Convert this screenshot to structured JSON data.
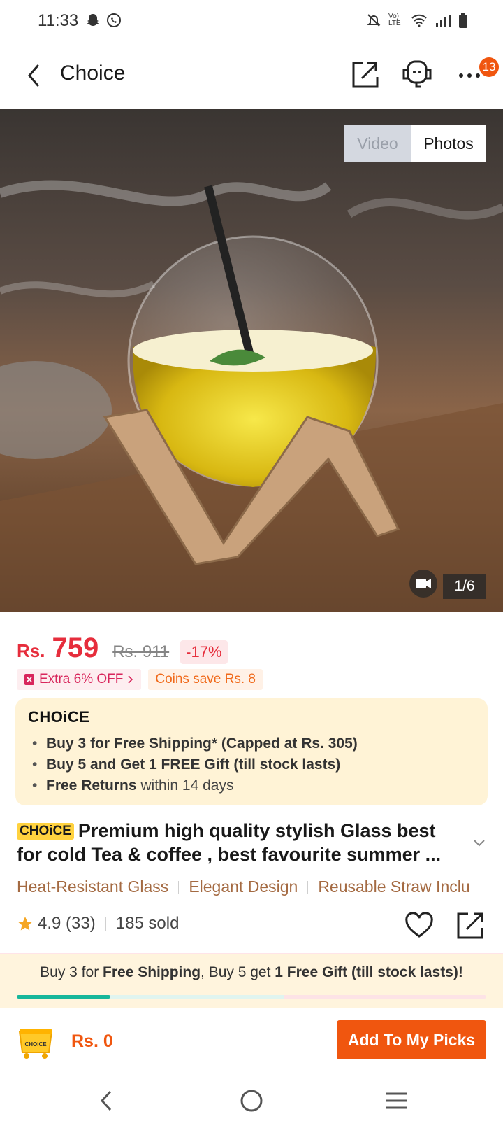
{
  "status": {
    "time": "11:33",
    "network_label": "Vo) LTE"
  },
  "header": {
    "title": "Choice",
    "cart_badge": "13"
  },
  "media": {
    "video_label": "Video",
    "photos_label": "Photos",
    "page_indicator": "1/6"
  },
  "price": {
    "currency": "Rs.",
    "current": "759",
    "original": "Rs. 911",
    "discount": "-17%"
  },
  "promos": {
    "extra_off": "Extra 6% OFF",
    "coins": "Coins save Rs. 8"
  },
  "choice_box": {
    "logo": "CHOiCE",
    "bullet1_bold": "Buy 3 for  Free Shipping* (Capped at Rs. 305)",
    "bullet2_bold": "Buy 5 and Get 1 FREE Gift (till stock lasts)",
    "bullet3_bold": "Free Returns",
    "bullet3_rest": " within 14 days"
  },
  "product": {
    "choice_tag": "CHOiCE",
    "title_line1": "Premium high quality stylish Glass best",
    "title_line2": "for cold Tea & coffee , best favourite summer ..."
  },
  "features": [
    "Heat-Resistant Glass",
    "Elegant Design",
    "Reusable Straw Inclu"
  ],
  "rating": {
    "score": "4.9 (33)",
    "sold": "185 sold"
  },
  "shipping_banner": {
    "part1": "Buy 3 for ",
    "part2": "Free Shipping",
    "part3": ", Buy 5 get ",
    "part4": "1 Free Gift (till stock lasts)!",
    "progress": 0.2
  },
  "bottom": {
    "cart_logo": "CHOICE",
    "total": "Rs. 0",
    "add_button": "Add To My Picks"
  }
}
